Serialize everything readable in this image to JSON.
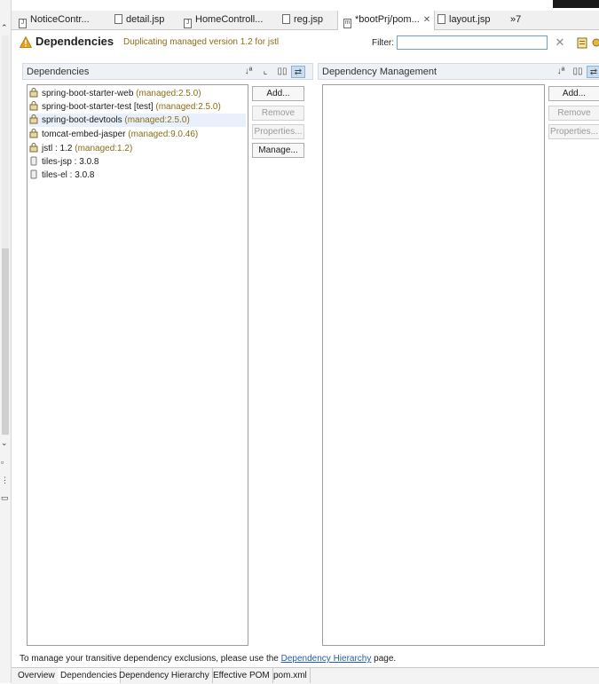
{
  "editor_tabs": [
    {
      "label": "NoticeContr...",
      "icon": "java-file-icon"
    },
    {
      "label": "detail.jsp",
      "icon": "jsp-file-icon"
    },
    {
      "label": "HomeControll...",
      "icon": "java-file-icon"
    },
    {
      "label": "reg.jsp",
      "icon": "jsp-file-icon"
    },
    {
      "label": "*bootPrj/pom...",
      "icon": "maven-pom-icon",
      "close": "✕"
    },
    {
      "label": "layout.jsp",
      "icon": "jsp-file-icon"
    }
  ],
  "tab_overflow": "»7",
  "header": {
    "title": "Dependencies",
    "warning": "Duplicating managed version 1.2 for jstl",
    "filter_label": "Filter:",
    "filter_value": ""
  },
  "dependencies": {
    "title": "Dependencies",
    "items": [
      {
        "name": "spring-boot-starter-web",
        "extra": "(managed:2.5.0)"
      },
      {
        "name": "spring-boot-starter-test [test]",
        "extra": "(managed:2.5.0)"
      },
      {
        "name": "spring-boot-devtools",
        "extra": "(managed:2.5.0)"
      },
      {
        "name": "tomcat-embed-jasper",
        "extra": "(managed:9.0.46)"
      },
      {
        "name": "jstl : 1.2",
        "extra": "(managed:1.2)"
      },
      {
        "name": "tiles-jsp : 3.0.8",
        "extra": ""
      },
      {
        "name": "tiles-el : 3.0.8",
        "extra": ""
      }
    ],
    "buttons": {
      "add": "Add...",
      "remove": "Remove",
      "properties": "Properties...",
      "manage": "Manage..."
    }
  },
  "dependency_management": {
    "title": "Dependency Management",
    "buttons": {
      "add": "Add...",
      "remove": "Remove",
      "properties": "Properties..."
    }
  },
  "footer": {
    "hint_before": "To manage your transitive dependency exclusions, please use the",
    "hint_link": "Dependency Hierarchy",
    "hint_after": "page."
  },
  "bottom_tabs": [
    "Overview",
    "Dependencies",
    "Dependency Hierarchy",
    "Effective POM",
    "pom.xml"
  ],
  "colors": {
    "accent": "#1f5fa8",
    "managed_text": "#8a6d1a",
    "warning_icon": "#e8a317"
  }
}
